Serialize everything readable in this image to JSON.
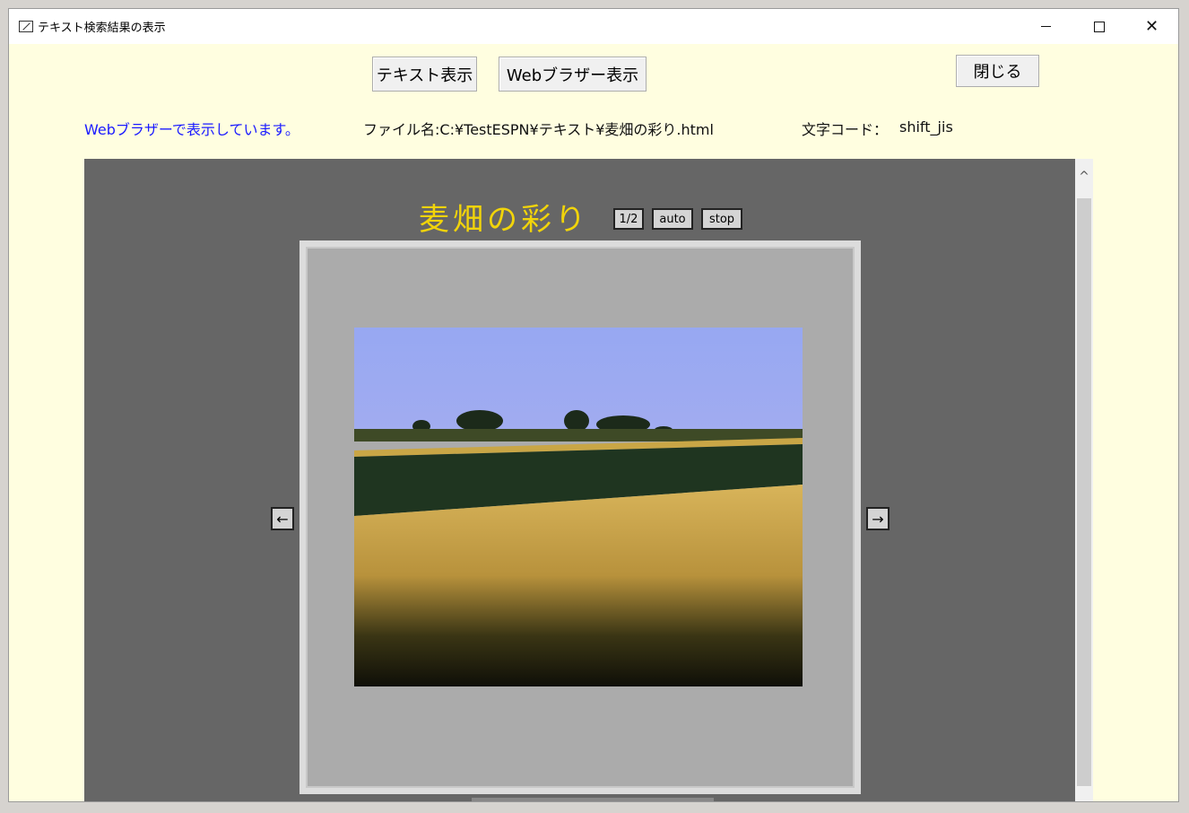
{
  "window": {
    "title": "テキスト検索結果の表示",
    "minimize": "",
    "maximize": "",
    "close": "✕"
  },
  "toolbar": {
    "text_view_label": "テキスト表示",
    "web_view_label": "Webブラザー表示",
    "close_label": "閉じる"
  },
  "info": {
    "status": "Webブラザーで表示しています。",
    "filename": "ファイル名:C:¥TestESPN¥テキスト¥麦畑の彩り.html",
    "encoding_label": "文字コード：",
    "encoding_value": "shift_jis"
  },
  "browser": {
    "page_title": "麦畑の彩り",
    "counter": "1/2",
    "auto_label": "auto",
    "stop_label": "stop",
    "prev_arrow": "←",
    "next_arrow": "→",
    "scroll_up": "^"
  },
  "colors": {
    "window_bg": "#fffee0",
    "status_blue": "#1a1aff",
    "browser_bg": "#666666",
    "title_yellow": "#f1d40a"
  }
}
